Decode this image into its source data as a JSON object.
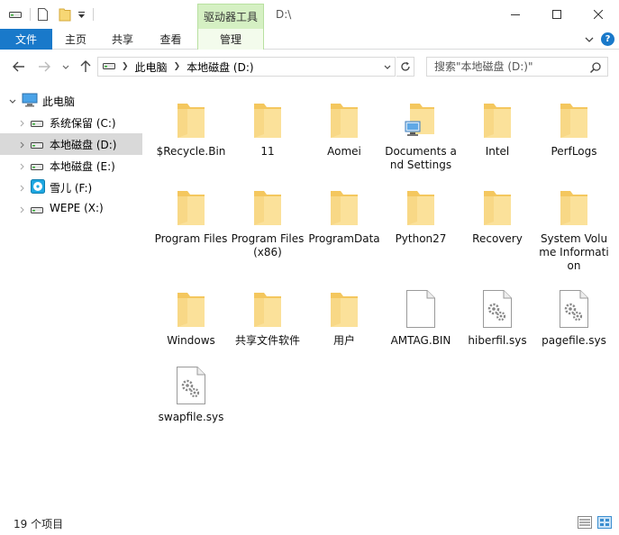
{
  "titlebar": {
    "context_tab_label": "驱动器工具",
    "path_title": "D:\\"
  },
  "ribbon": {
    "tabs": [
      {
        "label": "文件"
      },
      {
        "label": "主页"
      },
      {
        "label": "共享"
      },
      {
        "label": "查看"
      },
      {
        "label": "管理"
      }
    ],
    "accent_color": "#1979ca",
    "context_color": "#d5f0c3"
  },
  "address": {
    "crumbs": [
      "此电脑",
      "本地磁盘 (D:)"
    ]
  },
  "search": {
    "placeholder": "搜索\"本地磁盘 (D:)\""
  },
  "navpane": {
    "root": "此电脑",
    "drives": [
      {
        "label": "系统保留 (C:)",
        "icon": "hard-drive-icon"
      },
      {
        "label": "本地磁盘 (D:)",
        "icon": "hard-drive-icon",
        "selected": true
      },
      {
        "label": "本地磁盘 (E:)",
        "icon": "hard-drive-icon"
      },
      {
        "label": "雪儿 (F:)",
        "icon": "cd-drive-icon"
      },
      {
        "label": "WEPE (X:)",
        "icon": "hard-drive-icon"
      }
    ]
  },
  "files": [
    {
      "name": "$Recycle.Bin",
      "icon": "folder-icon"
    },
    {
      "name": "11",
      "icon": "folder-icon"
    },
    {
      "name": "Aomei",
      "icon": "folder-icon"
    },
    {
      "name": "Documents and Settings",
      "icon": "folder-shortcut-icon"
    },
    {
      "name": "Intel",
      "icon": "folder-icon"
    },
    {
      "name": "PerfLogs",
      "icon": "folder-icon"
    },
    {
      "name": "Program Files",
      "icon": "folder-icon"
    },
    {
      "name": "Program Files (x86)",
      "icon": "folder-icon"
    },
    {
      "name": "ProgramData",
      "icon": "folder-icon"
    },
    {
      "name": "Python27",
      "icon": "folder-icon"
    },
    {
      "name": "Recovery",
      "icon": "folder-icon"
    },
    {
      "name": "System Volume Information",
      "icon": "folder-icon"
    },
    {
      "name": "Windows",
      "icon": "folder-icon"
    },
    {
      "name": "共享文件软件",
      "icon": "folder-icon"
    },
    {
      "name": "用户",
      "icon": "folder-icon"
    },
    {
      "name": "AMTAG.BIN",
      "icon": "blank-file-icon"
    },
    {
      "name": "hiberfil.sys",
      "icon": "system-file-icon"
    },
    {
      "name": "pagefile.sys",
      "icon": "system-file-icon"
    },
    {
      "name": "swapfile.sys",
      "icon": "system-file-icon"
    }
  ],
  "status": {
    "item_count": "19 个项目"
  }
}
